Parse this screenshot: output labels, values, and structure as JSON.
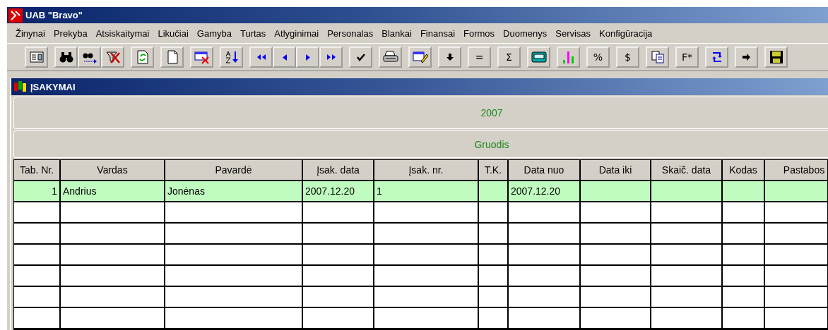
{
  "window": {
    "title": "UAB \"Bravo\""
  },
  "menu": [
    "Žinynai",
    "Prekyba",
    "Atsiskaitymai",
    "Likučiai",
    "Gamyba",
    "Turtas",
    "Atlyginimai",
    "Personalas",
    "Blankai",
    "Finansai",
    "Formos",
    "Duomenys",
    "Servisas",
    "Konfigūracija"
  ],
  "toolbar": [
    [
      {
        "kind": "form"
      }
    ],
    [
      {
        "kind": "binoculars"
      },
      {
        "kind": "find-next"
      },
      {
        "kind": "filter-off"
      }
    ],
    [
      {
        "kind": "refresh"
      }
    ],
    [
      {
        "kind": "new-page"
      }
    ],
    [
      {
        "kind": "delete-record"
      }
    ],
    [
      {
        "kind": "sort"
      }
    ],
    [
      {
        "kind": "first"
      },
      {
        "kind": "prev"
      },
      {
        "kind": "next"
      },
      {
        "kind": "last"
      }
    ],
    [
      {
        "kind": "check"
      }
    ],
    [
      {
        "kind": "print"
      }
    ],
    [
      {
        "kind": "edit"
      }
    ],
    [
      {
        "kind": "down"
      }
    ],
    [
      {
        "kind": "text",
        "label": "="
      }
    ],
    [
      {
        "kind": "text",
        "label": "Σ"
      }
    ],
    [
      {
        "kind": "calculator"
      }
    ],
    [
      {
        "kind": "chart"
      }
    ],
    [
      {
        "kind": "text",
        "label": "%"
      }
    ],
    [
      {
        "kind": "text",
        "label": "$"
      }
    ],
    [
      {
        "kind": "copy"
      }
    ],
    [
      {
        "kind": "text",
        "label": "F*"
      }
    ],
    [
      {
        "kind": "swap"
      }
    ],
    [
      {
        "kind": "forward"
      }
    ],
    [
      {
        "kind": "save"
      }
    ]
  ],
  "child_window": {
    "title": "ĮSAKYMAI",
    "year": "2007",
    "month": "Gruodis"
  },
  "table": {
    "columns": [
      "Tab. Nr.",
      "Vardas",
      "Pavardė",
      "Įsak. data",
      "Įsak. nr.",
      "T.K.",
      "Data nuo",
      "Data iki",
      "Skaič. data",
      "Kodas",
      "Pastabos"
    ],
    "rows": [
      {
        "selected": true,
        "cells": [
          "1",
          "Andrius",
          "Jonėnas",
          "2007.12.20",
          "1",
          "",
          "2007.12.20",
          "",
          "",
          "",
          ""
        ]
      }
    ]
  }
}
